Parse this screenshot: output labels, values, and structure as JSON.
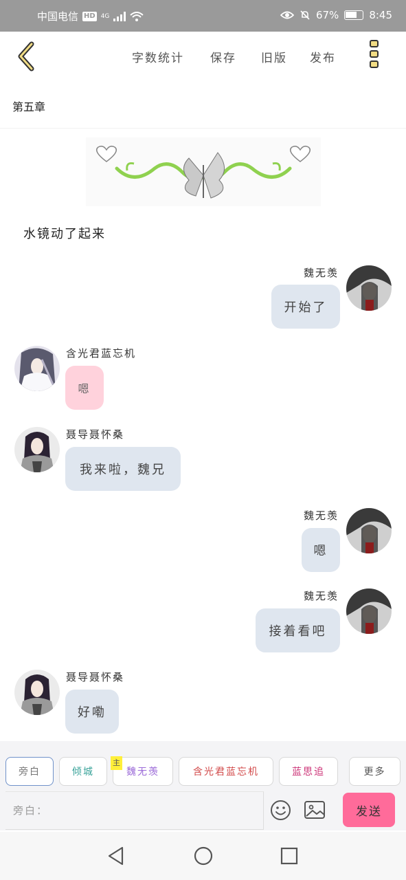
{
  "status_bar": {
    "carrier": "中国电信",
    "hd": "HD",
    "network": "4G",
    "battery": "67%",
    "time": "8:45"
  },
  "toolbar": {
    "word_count": "字数统计",
    "save": "保存",
    "old_version": "旧版",
    "publish": "发布"
  },
  "chapter_title": "第五章",
  "narration": "水镜动了起来",
  "messages": [
    {
      "sender": "魏无羡",
      "text": "开始了",
      "side": "right"
    },
    {
      "sender": "含光君蓝忘机",
      "text": "嗯",
      "side": "left"
    },
    {
      "sender": "聂导聂怀桑",
      "text": "我来啦，魏兄",
      "side": "left"
    },
    {
      "sender": "魏无羡",
      "text": "嗯",
      "side": "right"
    },
    {
      "sender": "魏无羡",
      "text": "接着看吧",
      "side": "right"
    },
    {
      "sender": "聂导聂怀桑",
      "text": "好嘞",
      "side": "left"
    }
  ],
  "roles": {
    "narrator": "旁白",
    "qingcheng": "倾城",
    "badge": "主",
    "wei": "魏无羡",
    "lan": "含光君蓝忘机",
    "lansizhui": "蓝思追",
    "more": "更多"
  },
  "input": {
    "placeholder": "旁白："
  },
  "send_label": "发送",
  "colors": {
    "accent_pink": "#ff6b9a",
    "bubble_blue": "#dfe6ef",
    "bubble_pink": "#ffd2dc",
    "status_bar": "#9a9a9a"
  }
}
